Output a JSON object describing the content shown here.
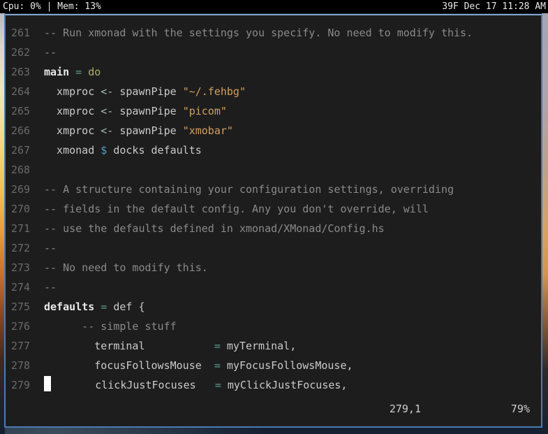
{
  "topbar": {
    "left": "Cpu: 0% | Mem: 13%",
    "right": "39F Dec 17 11:28 AM"
  },
  "editor": {
    "ruler": {
      "position": "279,1",
      "percent": "79%"
    },
    "cursor": {
      "line": 279,
      "col": 1
    },
    "lines": [
      {
        "num": "261",
        "segments": [
          {
            "style": "comment",
            "text": "-- Run xmonad with the settings you specify. No need to modify this."
          }
        ]
      },
      {
        "num": "262",
        "segments": [
          {
            "style": "comment",
            "text": "--"
          }
        ]
      },
      {
        "num": "263",
        "segments": [
          {
            "style": "def",
            "text": "main"
          },
          {
            "style": "fg",
            "text": " "
          },
          {
            "style": "operator",
            "text": "="
          },
          {
            "style": "fg",
            "text": " "
          },
          {
            "style": "keyword",
            "text": "do"
          }
        ]
      },
      {
        "num": "264",
        "segments": [
          {
            "style": "fg",
            "text": "  xmproc "
          },
          {
            "style": "arrow",
            "text": "<-"
          },
          {
            "style": "fg",
            "text": " spawnPipe "
          },
          {
            "style": "string",
            "text": "\"~/.fehbg\""
          }
        ]
      },
      {
        "num": "265",
        "segments": [
          {
            "style": "fg",
            "text": "  xmproc "
          },
          {
            "style": "arrow",
            "text": "<-"
          },
          {
            "style": "fg",
            "text": " spawnPipe "
          },
          {
            "style": "string",
            "text": "\"picom\""
          }
        ]
      },
      {
        "num": "266",
        "segments": [
          {
            "style": "fg",
            "text": "  xmproc "
          },
          {
            "style": "arrow",
            "text": "<-"
          },
          {
            "style": "fg",
            "text": " spawnPipe "
          },
          {
            "style": "string",
            "text": "\"xmobar\""
          }
        ]
      },
      {
        "num": "267",
        "segments": [
          {
            "style": "fg",
            "text": "  xmonad "
          },
          {
            "style": "dollar",
            "text": "$"
          },
          {
            "style": "fg",
            "text": " docks defaults"
          }
        ]
      },
      {
        "num": "268",
        "segments": []
      },
      {
        "num": "269",
        "segments": [
          {
            "style": "comment",
            "text": "-- A structure containing your configuration settings, overriding"
          }
        ]
      },
      {
        "num": "270",
        "segments": [
          {
            "style": "comment",
            "text": "-- fields in the default config. Any you don't override, will"
          }
        ]
      },
      {
        "num": "271",
        "segments": [
          {
            "style": "comment",
            "text": "-- use the defaults defined in xmonad/XMonad/Config.hs"
          }
        ]
      },
      {
        "num": "272",
        "segments": [
          {
            "style": "comment",
            "text": "--"
          }
        ]
      },
      {
        "num": "273",
        "segments": [
          {
            "style": "comment",
            "text": "-- No need to modify this."
          }
        ]
      },
      {
        "num": "274",
        "segments": [
          {
            "style": "comment",
            "text": "--"
          }
        ]
      },
      {
        "num": "275",
        "segments": [
          {
            "style": "def",
            "text": "defaults"
          },
          {
            "style": "fg",
            "text": " "
          },
          {
            "style": "operator",
            "text": "="
          },
          {
            "style": "fg",
            "text": " def {"
          }
        ]
      },
      {
        "num": "276",
        "segments": [
          {
            "style": "comment",
            "text": "      -- simple stuff"
          }
        ]
      },
      {
        "num": "277",
        "segments": [
          {
            "style": "fg",
            "text": "        terminal           "
          },
          {
            "style": "operator",
            "text": "="
          },
          {
            "style": "fg",
            "text": " myTerminal,"
          }
        ]
      },
      {
        "num": "278",
        "segments": [
          {
            "style": "fg",
            "text": "        focusFollowsMouse  "
          },
          {
            "style": "operator",
            "text": "="
          },
          {
            "style": "fg",
            "text": " myFocusFollowsMouse,"
          }
        ]
      },
      {
        "num": "279",
        "segments": [
          {
            "style": "cursor",
            "text": " "
          },
          {
            "style": "fg",
            "text": "       clickJustFocuses   "
          },
          {
            "style": "operator",
            "text": "="
          },
          {
            "style": "fg",
            "text": " myClickJustFocuses,"
          }
        ]
      }
    ]
  },
  "colors": {
    "background": "#1d1d1d",
    "border": "#4a7cb3",
    "topbar_bg": "#000000",
    "topbar_fg": "#e8e8e8",
    "line_number": "#6a6a6a",
    "foreground": "#cacaca",
    "comment": "#8a8a8a",
    "string": "#d2a05e",
    "keyword": "#a9b665",
    "operator": "#5f9e90",
    "dollar": "#4f9ec4",
    "arrow": "#a9bcb4",
    "definition": "#e9e9e9",
    "cursor": "#ffffff"
  }
}
